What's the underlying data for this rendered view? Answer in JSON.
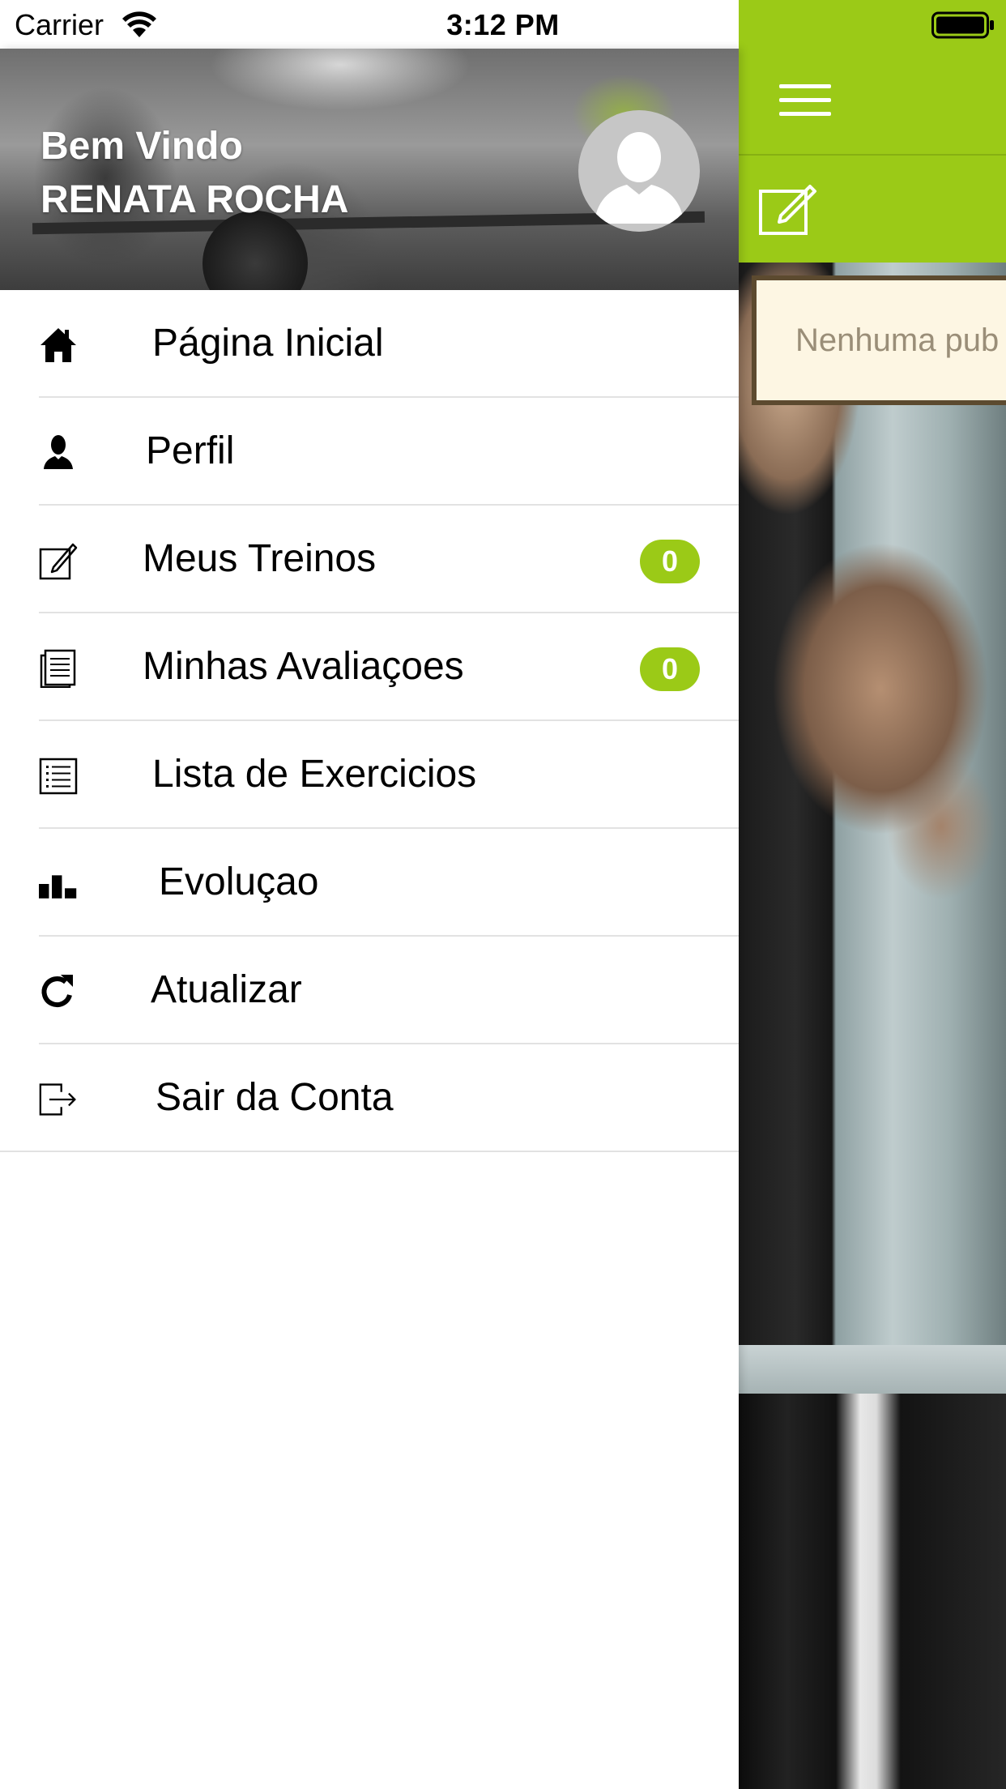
{
  "status_bar": {
    "carrier": "Carrier",
    "time": "3:12 PM"
  },
  "header": {
    "greeting": "Bem Vindo",
    "user_name": "RENATA ROCHA"
  },
  "menu": {
    "items": [
      {
        "label": "Página Inicial",
        "icon": "home-icon"
      },
      {
        "label": "Perfil",
        "icon": "user-icon"
      },
      {
        "label": "Meus Treinos",
        "icon": "edit-icon",
        "badge": "0"
      },
      {
        "label": "Minhas Avaliaçoes",
        "icon": "document-icon",
        "badge": "0"
      },
      {
        "label": "Lista de Exercicios",
        "icon": "list-icon"
      },
      {
        "label": "Evoluçao",
        "icon": "bar-chart-icon"
      },
      {
        "label": "Atualizar",
        "icon": "refresh-icon"
      },
      {
        "label": "Sair da Conta",
        "icon": "logout-icon"
      }
    ]
  },
  "main": {
    "notice": "Nenhuma pub"
  },
  "colors": {
    "accent": "#9bca17",
    "notice_background": "#fdf6e3",
    "notice_border": "#5c4a2f",
    "notice_text": "#9a8e78"
  }
}
